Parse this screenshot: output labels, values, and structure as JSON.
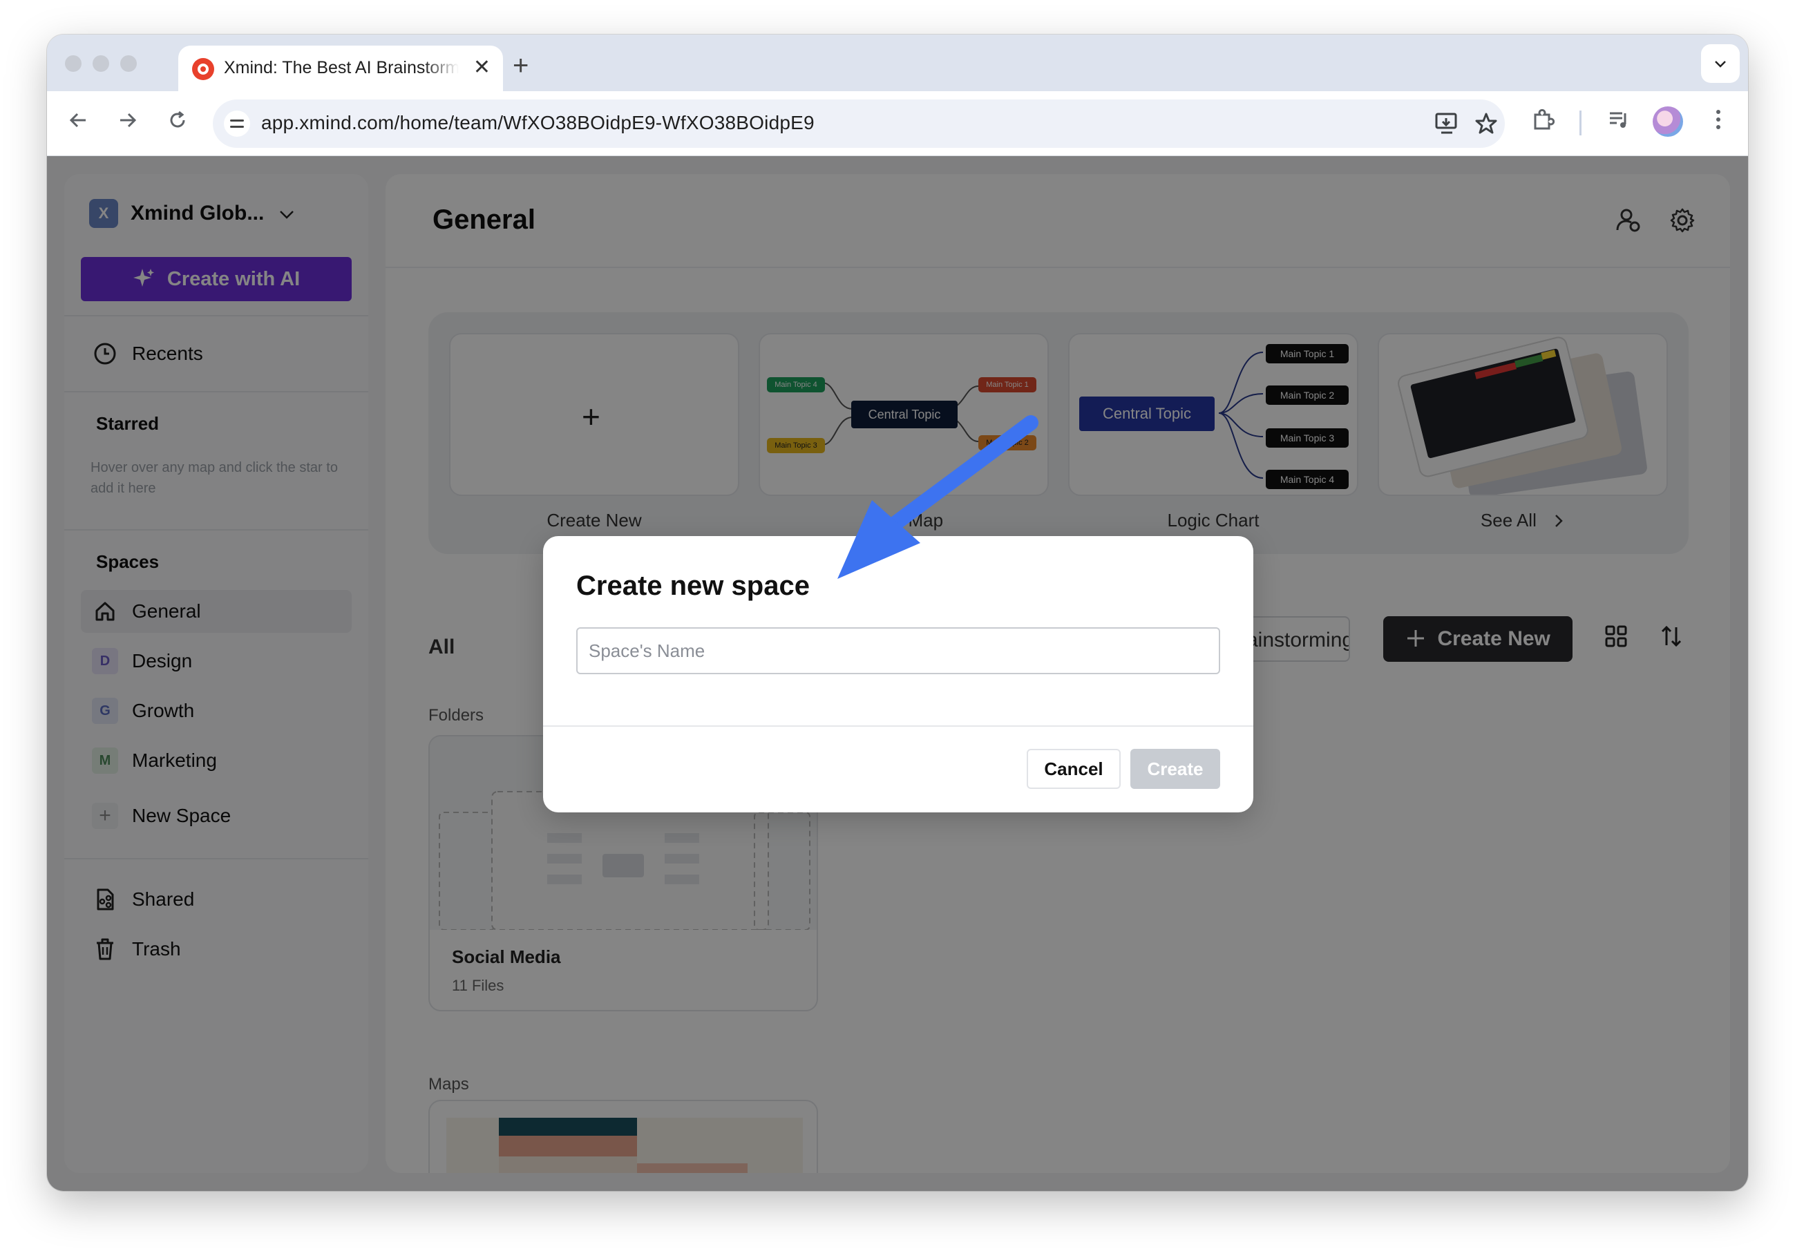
{
  "browser": {
    "tab_title": "Xmind: The Best AI Brainstorming and Mind Mapping App",
    "close_glyph": "✕",
    "new_tab_glyph": "+",
    "tab_list_glyph": "⌄",
    "url": "app.xmind.com/home/team/WfXO38BOidpE9-WfXO38BOidpE9"
  },
  "sidebar": {
    "workspace_initial": "X",
    "workspace_name": "Xmind Glob...",
    "create_ai_label": "Create with AI",
    "recents_label": "Recents",
    "starred_heading": "Starred",
    "starred_hint": "Hover over any map and click the star to add it here",
    "spaces_heading": "Spaces",
    "spaces": [
      {
        "initial": "",
        "label": "General"
      },
      {
        "initial": "D",
        "label": "Design"
      },
      {
        "initial": "G",
        "label": "Growth"
      },
      {
        "initial": "M",
        "label": "Marketing"
      }
    ],
    "new_space_label": "New Space",
    "shared_label": "Shared",
    "trash_label": "Trash"
  },
  "main": {
    "title": "General",
    "templates": [
      {
        "label": "Create New"
      },
      {
        "label": "Mind Map"
      },
      {
        "label": "Logic Chart"
      },
      {
        "label": "See All"
      }
    ],
    "template_texts": {
      "central_topic": "Central Topic",
      "main_topic_1": "Main Topic 1",
      "main_topic_2": "Main Topic 2",
      "main_topic_3": "Main Topic 3",
      "main_topic_4": "Main Topic 4"
    },
    "all_tab": "All",
    "brainstorming_btn": "Brainstorming",
    "create_new_btn": "Create New",
    "folders_label": "Folders",
    "folder": {
      "name": "Social Media",
      "meta": "11 Files"
    },
    "maps_label": "Maps"
  },
  "modal": {
    "title": "Create new space",
    "input_placeholder": "Space's Name",
    "input_value": "",
    "cancel_label": "Cancel",
    "create_label": "Create"
  },
  "colors": {
    "accent_purple": "#6b2edb",
    "annotation_arrow": "#3d73f0",
    "dark_button": "#2a2a2c"
  }
}
